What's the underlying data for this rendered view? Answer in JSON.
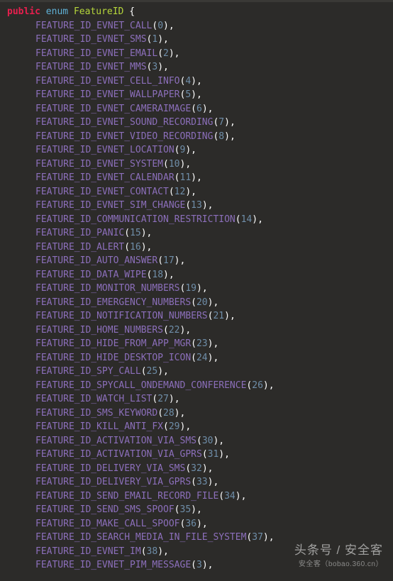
{
  "decl": {
    "kw_public": "public",
    "kw_enum": "enum",
    "name": "FeatureID",
    "brace_open": "{"
  },
  "enums": [
    {
      "name": "FEATURE_ID_EVNET_CALL",
      "value": "0"
    },
    {
      "name": "FEATURE_ID_EVNET_SMS",
      "value": "1"
    },
    {
      "name": "FEATURE_ID_EVNET_EMAIL",
      "value": "2"
    },
    {
      "name": "FEATURE_ID_EVNET_MMS",
      "value": "3"
    },
    {
      "name": "FEATURE_ID_EVNET_CELL_INFO",
      "value": "4"
    },
    {
      "name": "FEATURE_ID_EVNET_WALLPAPER",
      "value": "5"
    },
    {
      "name": "FEATURE_ID_EVNET_CAMERAIMAGE",
      "value": "6"
    },
    {
      "name": "FEATURE_ID_EVNET_SOUND_RECORDING",
      "value": "7"
    },
    {
      "name": "FEATURE_ID_EVNET_VIDEO_RECORDING",
      "value": "8"
    },
    {
      "name": "FEATURE_ID_EVNET_LOCATION",
      "value": "9"
    },
    {
      "name": "FEATURE_ID_EVNET_SYSTEM",
      "value": "10"
    },
    {
      "name": "FEATURE_ID_EVNET_CALENDAR",
      "value": "11"
    },
    {
      "name": "FEATURE_ID_EVNET_CONTACT",
      "value": "12"
    },
    {
      "name": "FEATURE_ID_EVNET_SIM_CHANGE",
      "value": "13"
    },
    {
      "name": "FEATURE_ID_COMMUNICATION_RESTRICTION",
      "value": "14"
    },
    {
      "name": "FEATURE_ID_PANIC",
      "value": "15"
    },
    {
      "name": "FEATURE_ID_ALERT",
      "value": "16"
    },
    {
      "name": "FEATURE_ID_AUTO_ANSWER",
      "value": "17"
    },
    {
      "name": "FEATURE_ID_DATA_WIPE",
      "value": "18"
    },
    {
      "name": "FEATURE_ID_MONITOR_NUMBERS",
      "value": "19"
    },
    {
      "name": "FEATURE_ID_EMERGENCY_NUMBERS",
      "value": "20"
    },
    {
      "name": "FEATURE_ID_NOTIFICATION_NUMBERS",
      "value": "21"
    },
    {
      "name": "FEATURE_ID_HOME_NUMBERS",
      "value": "22"
    },
    {
      "name": "FEATURE_ID_HIDE_FROM_APP_MGR",
      "value": "23"
    },
    {
      "name": "FEATURE_ID_HIDE_DESKTOP_ICON",
      "value": "24"
    },
    {
      "name": "FEATURE_ID_SPY_CALL",
      "value": "25"
    },
    {
      "name": "FEATURE_ID_SPYCALL_ONDEMAND_CONFERENCE",
      "value": "26"
    },
    {
      "name": "FEATURE_ID_WATCH_LIST",
      "value": "27"
    },
    {
      "name": "FEATURE_ID_SMS_KEYWORD",
      "value": "28"
    },
    {
      "name": "FEATURE_ID_KILL_ANTI_FX",
      "value": "29"
    },
    {
      "name": "FEATURE_ID_ACTIVATION_VIA_SMS",
      "value": "30"
    },
    {
      "name": "FEATURE_ID_ACTIVATION_VIA_GPRS",
      "value": "31"
    },
    {
      "name": "FEATURE_ID_DELIVERY_VIA_SMS",
      "value": "32"
    },
    {
      "name": "FEATURE_ID_DELIVERY_VIA_GPRS",
      "value": "33"
    },
    {
      "name": "FEATURE_ID_SEND_EMAIL_RECORD_FILE",
      "value": "34"
    },
    {
      "name": "FEATURE_ID_SEND_SMS_SPOOF",
      "value": "35"
    },
    {
      "name": "FEATURE_ID_MAKE_CALL_SPOOF",
      "value": "36"
    },
    {
      "name": "FEATURE_ID_SEARCH_MEDIA_IN_FILE_SYSTEM",
      "value": "37"
    },
    {
      "name": "FEATURE_ID_EVNET_IM",
      "value": "38"
    },
    {
      "name": "FEATURE_ID_EVNET_PIM_MESSAGE",
      "value": "3"
    }
  ],
  "watermark": {
    "main": "头条号 / 安全客",
    "sub": "安全客（bobao.360.cn）"
  }
}
